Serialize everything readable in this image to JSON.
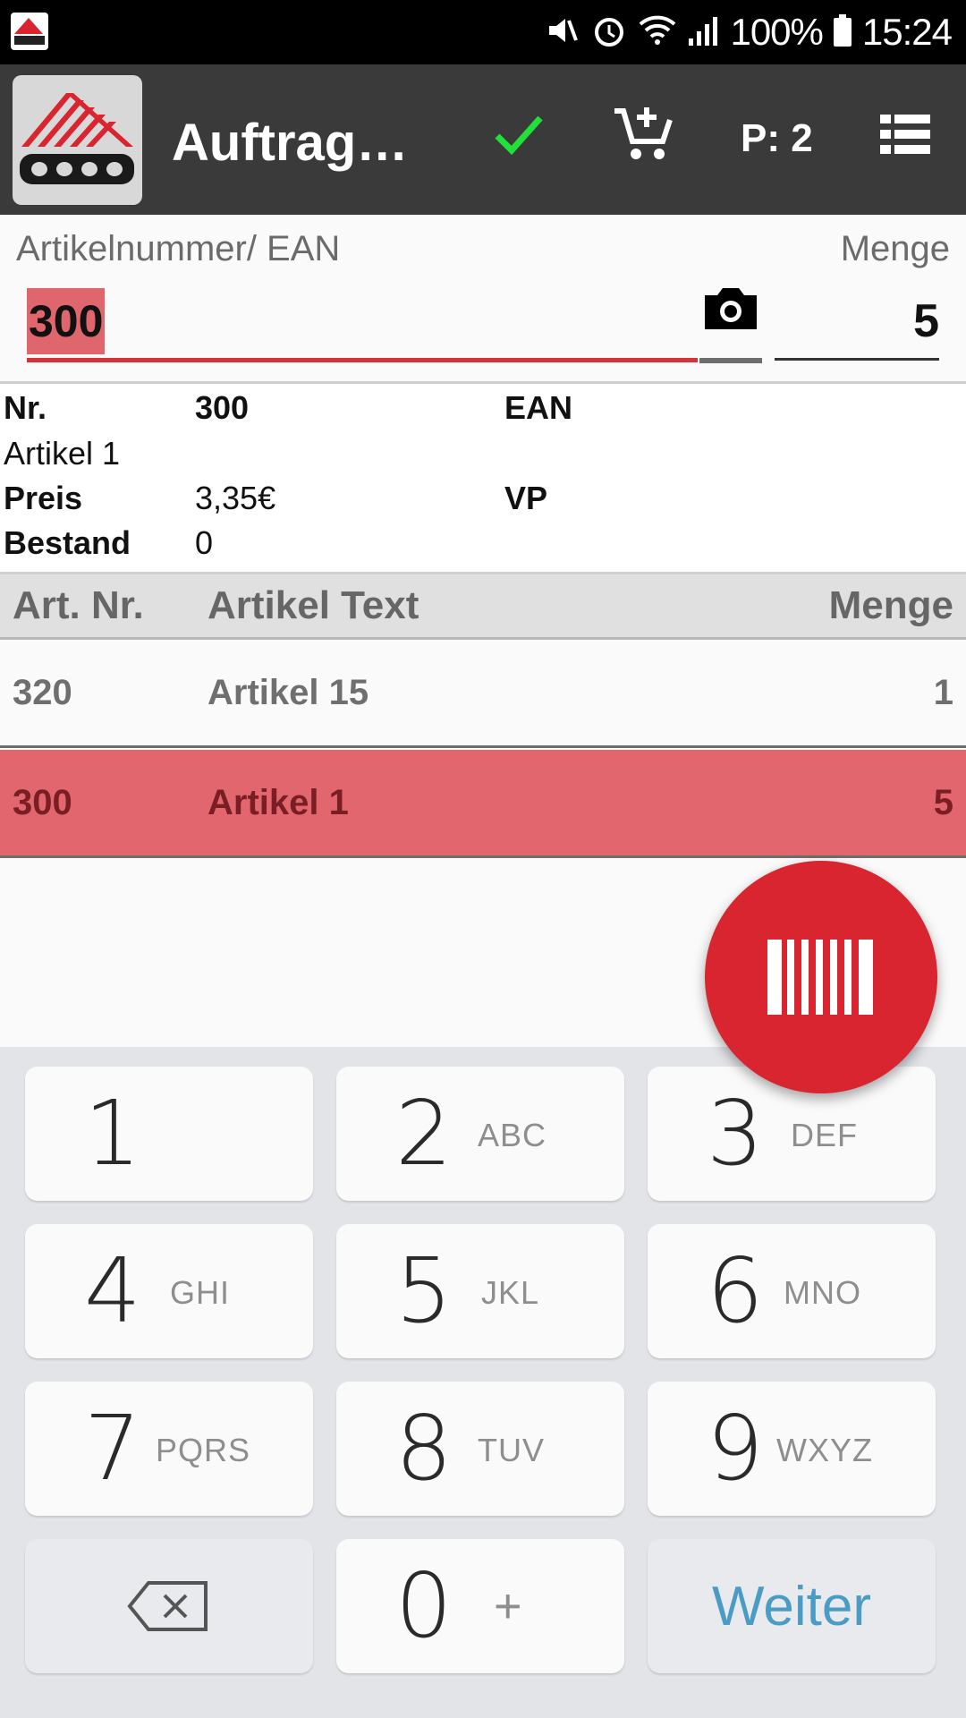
{
  "status_bar": {
    "battery": "100%",
    "time": "15:24",
    "icons": [
      "app-icon",
      "mute-icon",
      "alarm-icon",
      "wifi-icon",
      "signal-icon",
      "battery-icon"
    ]
  },
  "toolbar": {
    "title": "Auftragserfassung",
    "confirm_icon": "check-icon",
    "cart_icon": "add-to-cart-icon",
    "position_count": "P: 2",
    "list_icon": "list-icon",
    "accent_check_color": "#22e03a"
  },
  "input": {
    "article_label": "Artikelnummer/ EAN",
    "quantity_label": "Menge",
    "article_value": "300",
    "quantity_value": "5",
    "camera_icon": "camera-icon"
  },
  "detail": {
    "nr_label": "Nr.",
    "nr_value": "300",
    "ean_label": "EAN",
    "name": "Artikel 1",
    "price_label": "Preis",
    "price_value": "3,35€",
    "vp_label": "VP",
    "stock_label": "Bestand",
    "stock_value": "0"
  },
  "table": {
    "headers": [
      "Art. Nr.",
      "Artikel Text",
      "Menge"
    ],
    "rows": [
      {
        "nr": "320",
        "text": "Artikel 15",
        "qty": "1",
        "selected": false
      },
      {
        "nr": "300",
        "text": "Artikel 1",
        "qty": "5",
        "selected": true
      }
    ]
  },
  "fab": {
    "icon": "barcode-icon",
    "color": "#d9252f"
  },
  "keypad": {
    "keys": [
      {
        "num": "1",
        "letters": ""
      },
      {
        "num": "2",
        "letters": "ABC"
      },
      {
        "num": "3",
        "letters": "DEF"
      },
      {
        "num": "4",
        "letters": "GHI"
      },
      {
        "num": "5",
        "letters": "JKL"
      },
      {
        "num": "6",
        "letters": "MNO"
      },
      {
        "num": "7",
        "letters": "PQRS"
      },
      {
        "num": "8",
        "letters": "TUV"
      },
      {
        "num": "9",
        "letters": "WXYZ"
      },
      {
        "num": "0",
        "letters": "+"
      }
    ],
    "backspace_icon": "backspace-icon",
    "next_label": "Weiter"
  }
}
